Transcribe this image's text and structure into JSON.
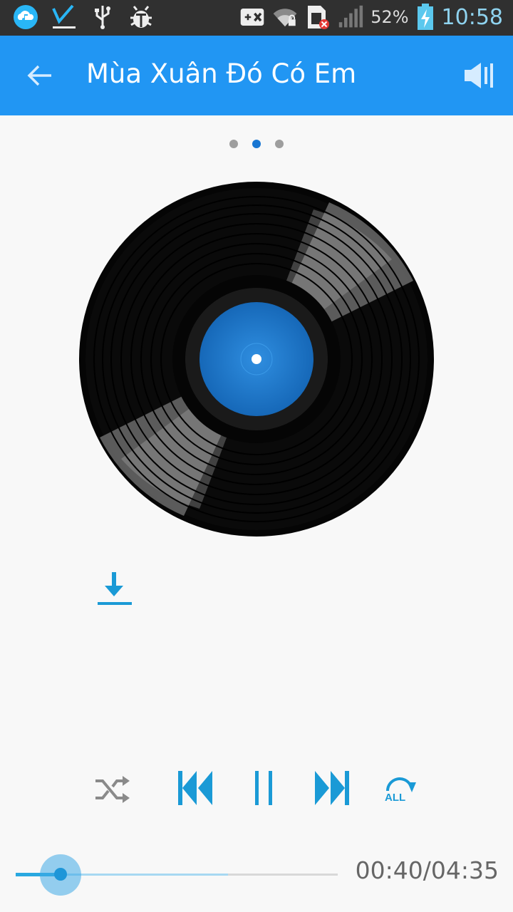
{
  "status_bar": {
    "battery_percent": "52%",
    "time": "10:58",
    "icons": [
      "music-cloud-icon",
      "check-icon",
      "usb-icon",
      "debug-bug-icon",
      "gamepad-blocked-icon",
      "wifi-locked-icon",
      "sim-error-icon",
      "signal-icon",
      "battery-charging-icon"
    ]
  },
  "app_bar": {
    "title": "Mùa Xuân Đó Có Em",
    "back_icon": "arrow-left-icon",
    "volume_icon": "volume-icon"
  },
  "pager": {
    "pages": 3,
    "active_index": 1
  },
  "player": {
    "elapsed": "00:40",
    "duration": "04:35",
    "time_display": "00:40/04:35",
    "progress_fraction": 0.14,
    "buffered_fraction": 0.66,
    "repeat_label": "ALL",
    "controls": [
      "shuffle-icon",
      "previous-icon",
      "pause-icon",
      "next-icon",
      "repeat-all-icon"
    ]
  },
  "colors": {
    "app_bar": "#2196f3",
    "accent": "#1a9ad6",
    "label_center": "#1e78c8",
    "status_bar": "#303030"
  }
}
